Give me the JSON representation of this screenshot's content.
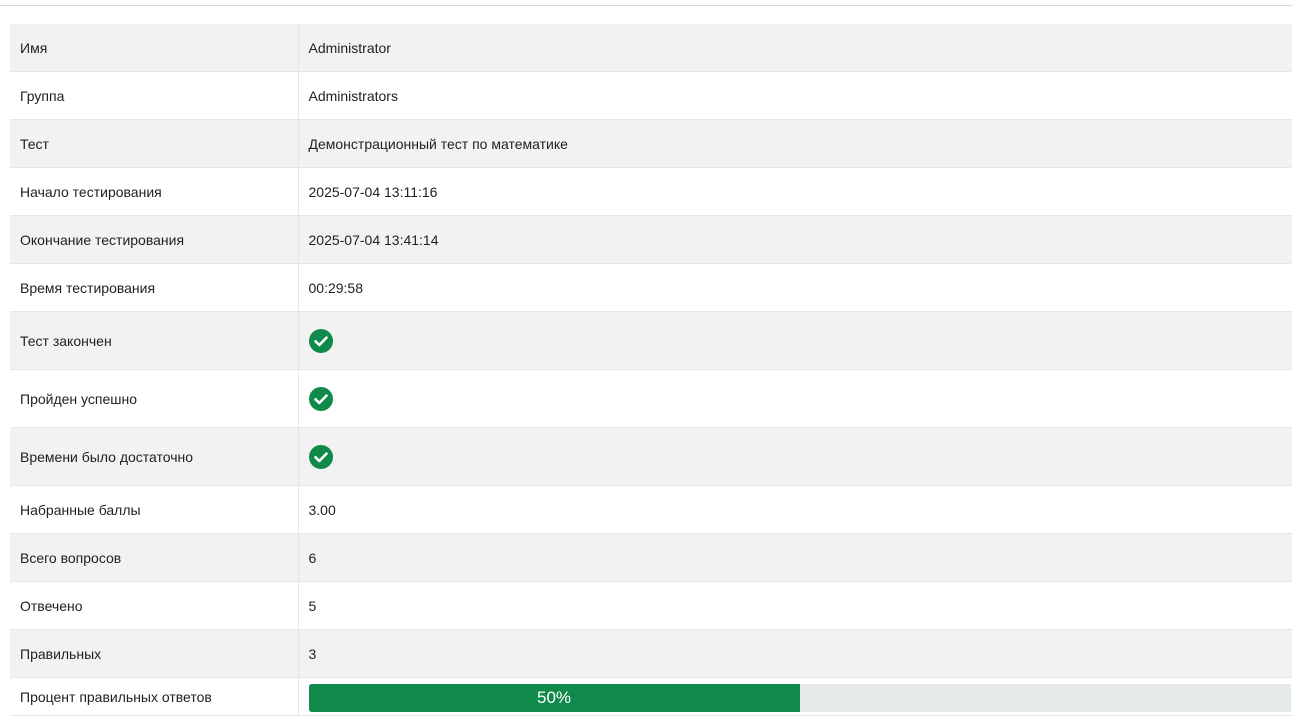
{
  "rows": [
    {
      "label": "Имя",
      "value": "Administrator"
    },
    {
      "label": "Группа",
      "value": "Administrators"
    },
    {
      "label": "Тест",
      "value": "Демонстрационный тест по математике"
    },
    {
      "label": "Начало тестирования",
      "value": "2025-07-04 13:11:16"
    },
    {
      "label": "Окончание тестирования",
      "value": "2025-07-04 13:41:14"
    },
    {
      "label": "Время тестирования",
      "value": "00:29:58"
    },
    {
      "label": "Тест закончен",
      "icon": "check-circle-icon",
      "checked": true
    },
    {
      "label": "Пройден успешно",
      "icon": "check-circle-icon",
      "checked": true
    },
    {
      "label": "Времени было достаточно",
      "icon": "check-circle-icon",
      "checked": true
    },
    {
      "label": "Набранные баллы",
      "value": "3.00"
    },
    {
      "label": "Всего вопросов",
      "value": "6"
    },
    {
      "label": "Отвечено",
      "value": "5"
    },
    {
      "label": "Правильных",
      "value": "3"
    },
    {
      "label": "Процент правильных ответов",
      "progress_text": "50%",
      "progress_percent": 50
    }
  ],
  "colors": {
    "check_green": "#0f8a4a",
    "progress_fill": "#0f8a4a",
    "progress_track": "#e6ebea",
    "row_alt": "#f2f2f2"
  }
}
